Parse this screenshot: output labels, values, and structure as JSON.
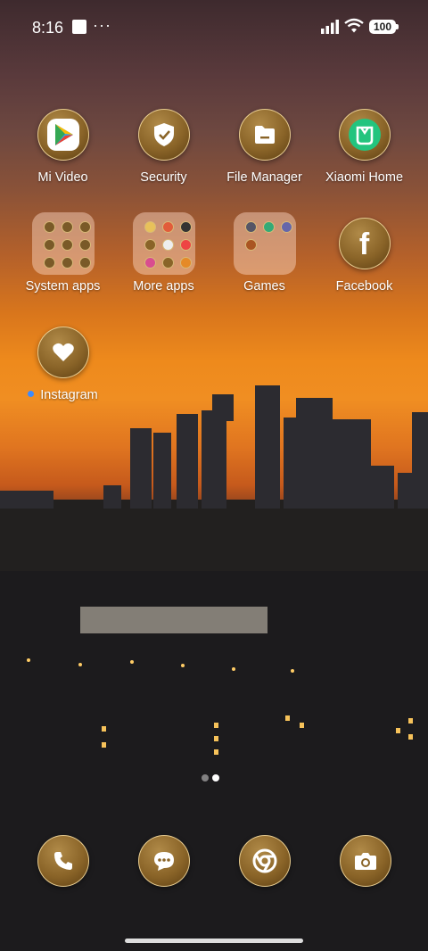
{
  "status": {
    "time": "8:16",
    "battery": "100"
  },
  "row1": [
    {
      "label": "Mi Video"
    },
    {
      "label": "Security"
    },
    {
      "label": "File Manager"
    },
    {
      "label": "Xiaomi Home"
    }
  ],
  "row2": [
    {
      "label": "System apps"
    },
    {
      "label": "More apps"
    },
    {
      "label": "Games"
    },
    {
      "label": "Facebook"
    }
  ],
  "row3": [
    {
      "label": "Instagram"
    }
  ],
  "dock": [
    {
      "icon": "phone-icon"
    },
    {
      "icon": "messages-icon"
    },
    {
      "icon": "chrome-icon"
    },
    {
      "icon": "camera-icon"
    }
  ],
  "pages": {
    "count": 2,
    "current": 2
  }
}
